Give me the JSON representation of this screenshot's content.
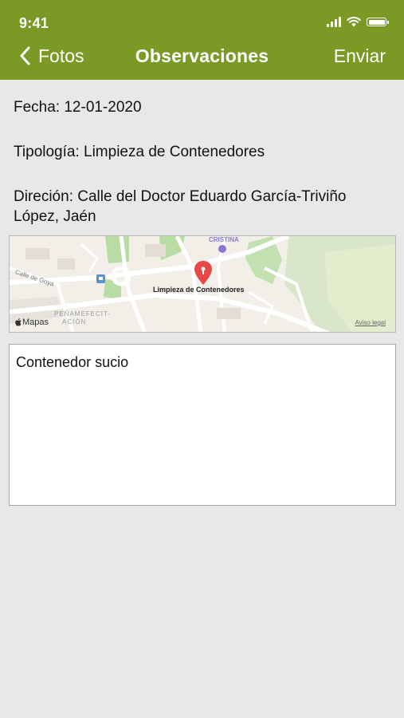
{
  "status_bar": {
    "time": "9:41",
    "icons": [
      "cellular-signal-icon",
      "wifi-icon",
      "battery-icon"
    ]
  },
  "nav": {
    "back_label": "Fotos",
    "title": "Observaciones",
    "send_label": "Enviar",
    "color": "#7a9a25"
  },
  "report": {
    "date": "Fecha: 12-01-2020",
    "type": "Tipología: Limpieza de Contenedores",
    "address": "Direción: Calle del Doctor Eduardo García-Triviño López, Jaén"
  },
  "map": {
    "pin_label": "Limpieza de Contenedores",
    "pin_color": "#e84848",
    "provider": "Mapas",
    "legal": "Aviso legal",
    "street_labels": [
      "Calle de Goya",
      "CRISTINA",
      "PEÑAMEFECIT-",
      "ACIÓN"
    ]
  },
  "observations": {
    "text": "Contenedor sucio"
  }
}
